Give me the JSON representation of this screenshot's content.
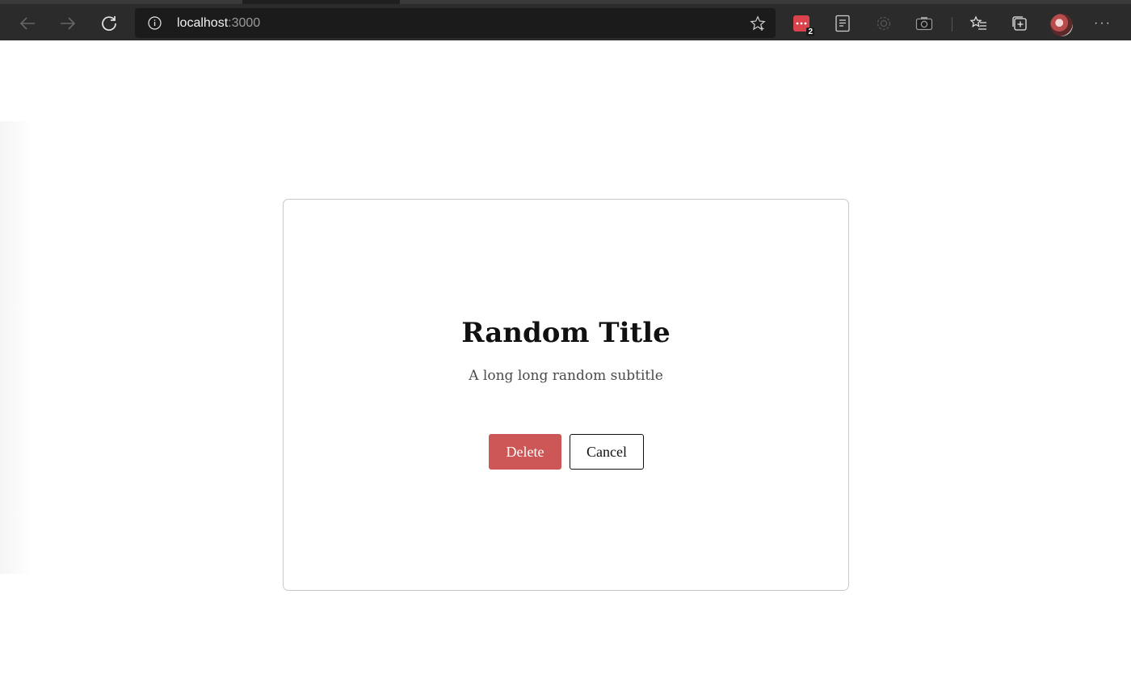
{
  "browser": {
    "url_host": "localhost",
    "url_port": ":3000",
    "extension_badge": "2",
    "icons": {
      "back": "arrow-left-icon",
      "forward": "arrow-right-icon",
      "reload": "reload-icon",
      "site_info": "info-icon",
      "favorite": "star-icon",
      "extension": "extension-icon",
      "reader": "reader-view-icon",
      "settings": "gear-icon",
      "screenshot": "camera-icon",
      "favorites_list": "favorites-icon",
      "collections": "collections-icon",
      "profile": "avatar",
      "more": "more-icon"
    }
  },
  "dialog": {
    "title": "Random Title",
    "subtitle": "A long long random subtitle",
    "delete_label": "Delete",
    "cancel_label": "Cancel"
  },
  "colors": {
    "toolbar_bg": "#2b2b2b",
    "address_bg": "#1b1b1b",
    "delete_bg": "#cd5656",
    "extension_red": "#d9434b"
  }
}
